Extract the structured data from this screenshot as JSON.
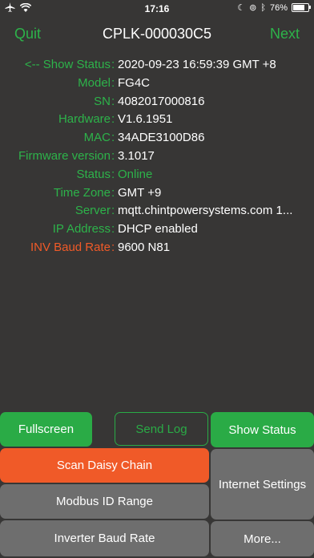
{
  "status_bar": {
    "time": "17:16",
    "battery": "76%",
    "battery_level": 0.76
  },
  "nav": {
    "quit": "Quit",
    "title": "CPLK-000030C5",
    "next": "Next"
  },
  "info_rows": [
    {
      "label": "<-- Show Status",
      "value": "2020-09-23 16:59:39 GMT +8"
    },
    {
      "label": "Model",
      "value": "FG4C"
    },
    {
      "label": "SN",
      "value": "4082017000816"
    },
    {
      "label": "Hardware",
      "value": "V1.6.1951"
    },
    {
      "label": "MAC",
      "value": "34ADE3100D86"
    },
    {
      "label": "Firmware version",
      "value": "3.1017"
    },
    {
      "label": "Status",
      "value": "Online"
    },
    {
      "label": "Time Zone",
      "value": "GMT +9"
    },
    {
      "label": "Server",
      "value": "mqtt.chintpowersystems.com 1..."
    },
    {
      "label": "IP Address",
      "value": "DHCP enabled"
    },
    {
      "label": "INV Baud Rate",
      "value": "9600 N81"
    }
  ],
  "separator": ":",
  "buttons": {
    "fullscreen": "Fullscreen",
    "send_log": "Send Log",
    "show_status": "Show Status",
    "scan_daisy_chain": "Scan Daisy Chain",
    "internet_settings": "Internet Settings",
    "modbus_id_range": "Modbus ID Range",
    "inverter_baud_rate": "Inverter Baud Rate",
    "more": "More..."
  },
  "colors": {
    "accent_green": "#2aab46",
    "accent_orange": "#f05a28",
    "background": "#373635",
    "button_gray": "#6e6e6e"
  }
}
